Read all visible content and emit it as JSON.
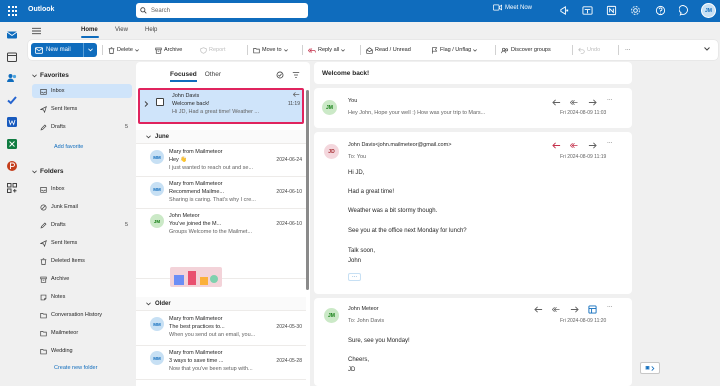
{
  "app": {
    "title": "Outlook"
  },
  "search": {
    "placeholder": "Search"
  },
  "topbar": {
    "meet_now": "Meet Now",
    "avatar": "JM"
  },
  "tabs": [
    {
      "label": "Home"
    },
    {
      "label": "View"
    },
    {
      "label": "Help"
    }
  ],
  "ribbon": {
    "new_mail": "New mail",
    "delete": "Delete",
    "archive": "Archive",
    "report": "Report",
    "move_to": "Move to",
    "reply_all": "Reply all",
    "read_unread": "Read / Unread",
    "flag_unflag": "Flag / Unflag",
    "discover_groups": "Discover groups",
    "undo": "Undo",
    "more": "···"
  },
  "favorites": {
    "title": "Favorites",
    "items": [
      {
        "label": "Inbox",
        "count": "",
        "icon": "inbox-icon"
      },
      {
        "label": "Sent Items",
        "count": "",
        "icon": "send-icon"
      },
      {
        "label": "Drafts",
        "count": "5",
        "icon": "pencil-icon"
      }
    ],
    "add_link": "Add favorite"
  },
  "folders": {
    "title": "Folders",
    "items": [
      {
        "label": "Inbox",
        "count": "",
        "icon": "inbox-icon"
      },
      {
        "label": "Junk Email",
        "count": "",
        "icon": "junk-icon"
      },
      {
        "label": "Drafts",
        "count": "5",
        "icon": "pencil-icon"
      },
      {
        "label": "Sent Items",
        "count": "",
        "icon": "send-icon"
      },
      {
        "label": "Deleted Items",
        "count": "",
        "icon": "trash-icon"
      },
      {
        "label": "Archive",
        "count": "",
        "icon": "archive-icon"
      },
      {
        "label": "Notes",
        "count": "",
        "icon": "note-icon"
      },
      {
        "label": "Conversation History",
        "count": "",
        "icon": "folder-icon"
      },
      {
        "label": "Mailmeteor",
        "count": "",
        "icon": "folder-icon"
      },
      {
        "label": "Wedding",
        "count": "",
        "icon": "folder-icon"
      }
    ],
    "create_link": "Create new folder"
  },
  "list": {
    "tab_focused": "Focused",
    "tab_other": "Other",
    "selected": {
      "from": "John Davis",
      "subject": "Welcome back!",
      "time": "11:19",
      "preview": "Hi JD, Had a great time! Weather ..."
    },
    "group_june": "June",
    "group_older": "Older",
    "june": [
      {
        "initials": "MM",
        "from": "Mary from Mailmeteor",
        "subject": "Hey 👋",
        "date": "2024-06-24",
        "preview": "I just wanted to reach out and se..."
      },
      {
        "initials": "MM",
        "from": "Mary from Mailmeteor",
        "subject": "Recommend Mailme...",
        "date": "2024-06-10",
        "preview": "Sharing is caring. That's why I cre..."
      },
      {
        "initials": "JM",
        "from": "John Meteor",
        "subject": "You've joined the M...",
        "date": "2024-06-10",
        "preview": "Groups Welcome to the Mailmet..."
      }
    ],
    "older": [
      {
        "initials": "MM",
        "from": "Mary from Mailmeteor",
        "subject": "The best practices to...",
        "date": "2024-05-30",
        "preview": "When you send out an email, you..."
      },
      {
        "initials": "MM",
        "from": "Mary from Mailmeteor",
        "subject": "3 ways to save time ...",
        "date": "2024-05-28",
        "preview": "Now that you've been setup with..."
      }
    ]
  },
  "reading": {
    "subject": "Welcome back!",
    "msg1": {
      "initials": "JM",
      "from": "You",
      "preview": "Hey John, Hope your well :) How was your trip to Mars...",
      "date": "Fri 2024-08-09 11:03"
    },
    "msg2": {
      "initials": "JD",
      "from": "John Davis<john.mailmeteor@gmail.com>",
      "to_label": "To:",
      "to": "You",
      "date": "Fri 2024-08-09 11:19",
      "body": [
        "Hi JD,",
        "Had a great time!",
        "Weather was a bit stormy though.",
        "See you at the office next Monday for lunch?",
        "Talk soon,",
        "John"
      ],
      "more": "···"
    },
    "msg3": {
      "initials": "JM",
      "from": "John Meteor",
      "to_label": "To:",
      "to": "John Davis",
      "date": "Fri 2024-08-09 11:20",
      "body": [
        "Sure, see you Monday!",
        "Cheers,",
        "JD"
      ]
    }
  },
  "colors": {
    "brand": "#0f6cbd",
    "selection": "#cfe4fa",
    "highlight_border": "#e0245e"
  }
}
